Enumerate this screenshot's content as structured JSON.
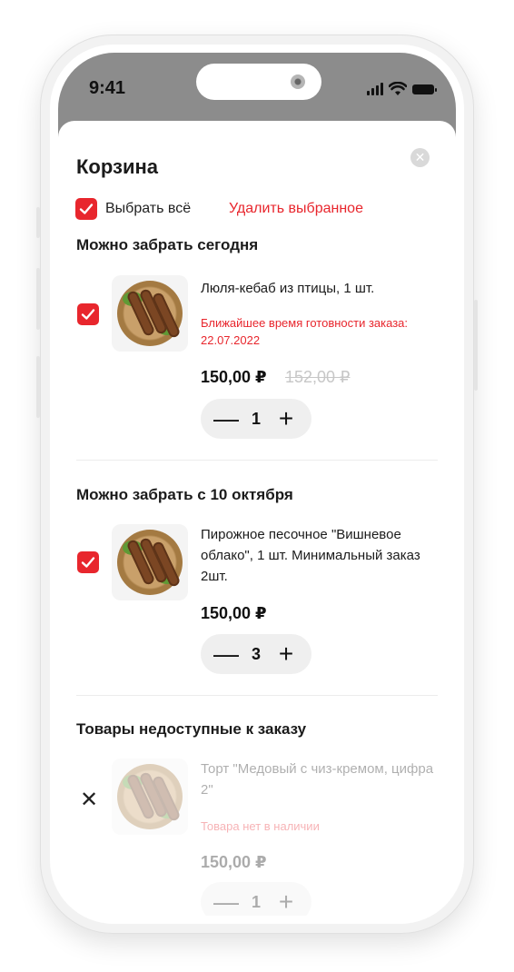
{
  "status_bar": {
    "time": "9:41"
  },
  "cart": {
    "title": "Корзина",
    "close_icon": "close-icon",
    "select_all_label": "Выбрать всё",
    "delete_selected_label": "Удалить выбранное",
    "accent_color": "#e8262d",
    "sections": [
      {
        "title": "Можно забрать сегодня",
        "item": {
          "name": "Люля-кебаб из птицы, 1 шт.",
          "note": "Ближайшее время готовности заказа: 22.07.2022",
          "price": "150,00 ₽",
          "old_price": "152,00 ₽",
          "quantity": "1",
          "checked": true
        }
      },
      {
        "title": "Можно забрать с 10 октября",
        "item": {
          "name": "Пирожное песочное \"Вишневое облако\", 1 шт. Минимальный заказ 2шт.",
          "price": "150,00 ₽",
          "quantity": "3",
          "checked": true
        }
      },
      {
        "title": "Товары недоступные к заказу",
        "item": {
          "name": "Торт \"Медовый с чиз-кремом, цифра 2\"",
          "note": "Товара нет в наличии",
          "price": "150,00 ₽",
          "quantity": "1",
          "unavailable": true
        }
      }
    ],
    "stepper": {
      "minus": "—",
      "plus": "+"
    }
  }
}
